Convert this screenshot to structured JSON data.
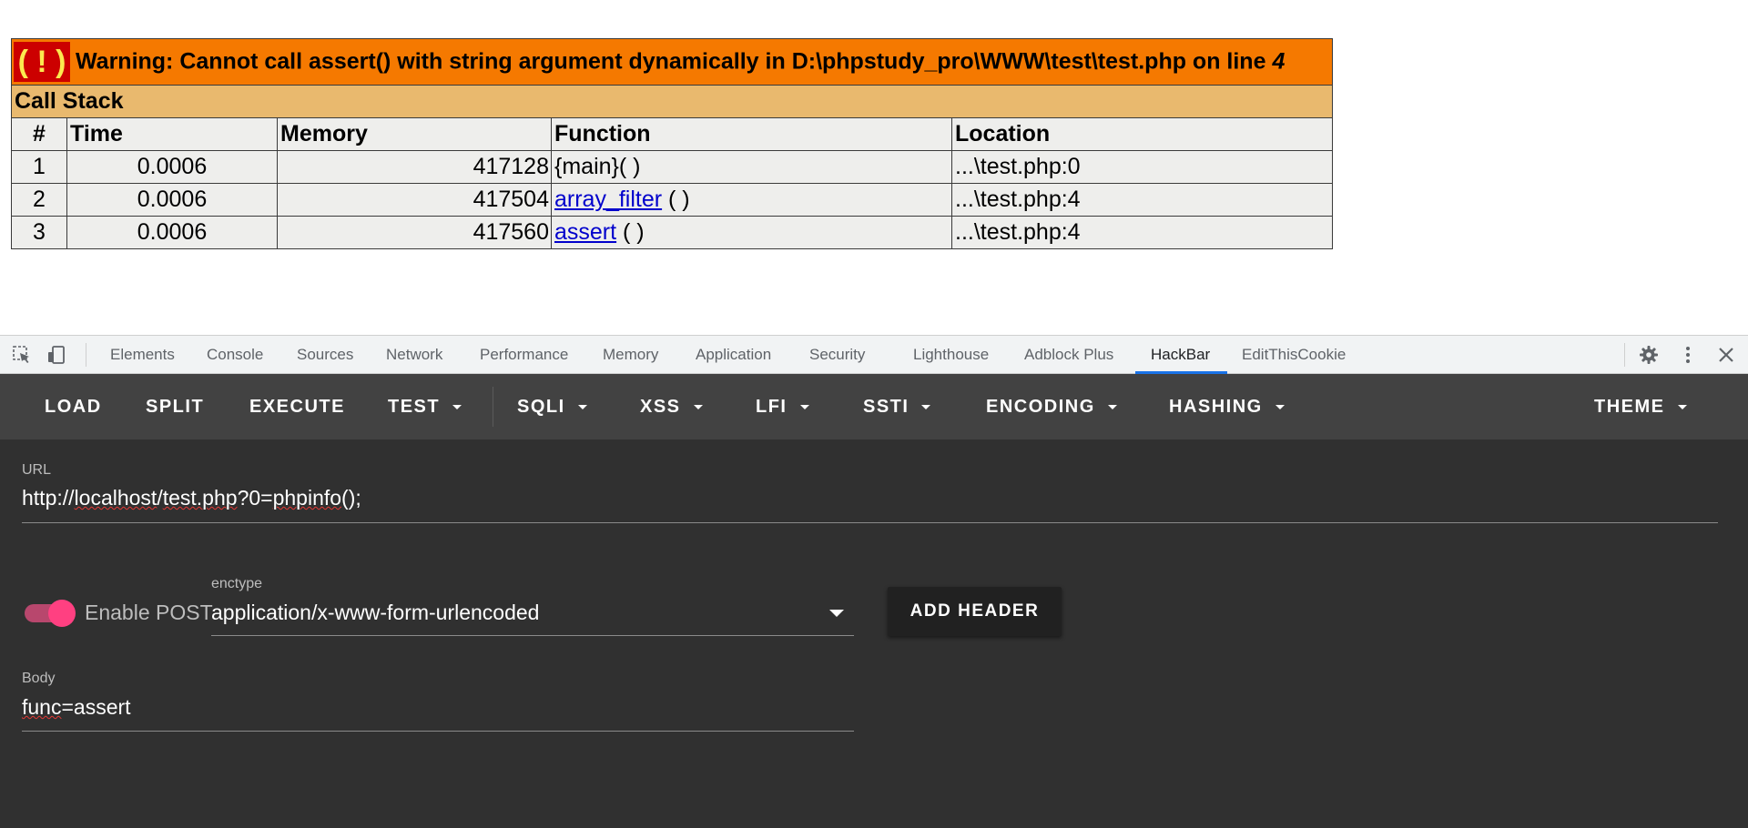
{
  "xdebug": {
    "warning_icon": "( ! )",
    "warning_text": "Warning: Cannot call assert() with string argument dynamically in D:\\phpstudy_pro\\WWW\\test\\test.php on line",
    "warning_line": "4",
    "call_stack_title": "Call Stack",
    "columns": [
      "#",
      "Time",
      "Memory",
      "Function",
      "Location"
    ],
    "rows": [
      {
        "num": "1",
        "time": "0.0006",
        "memory": "417128",
        "func_name": "",
        "func_plain": "{main}( )",
        "func_args": "",
        "location": "...\\test.php:0"
      },
      {
        "num": "2",
        "time": "0.0006",
        "memory": "417504",
        "func_name": "array_filter",
        "func_plain": "",
        "func_args": " ( )",
        "location": "...\\test.php:4"
      },
      {
        "num": "3",
        "time": "0.0006",
        "memory": "417560",
        "func_name": "assert",
        "func_plain": "",
        "func_args": " ( )",
        "location": "...\\test.php:4"
      }
    ]
  },
  "devtools": {
    "tabs": [
      "Elements",
      "Console",
      "Sources",
      "Network",
      "Performance",
      "Memory",
      "Application",
      "Security",
      "Lighthouse",
      "Adblock Plus",
      "HackBar",
      "EditThisCookie"
    ],
    "active_tab": "HackBar",
    "accent": "#1a73e8"
  },
  "hackbar": {
    "toolbar": {
      "load": "LOAD",
      "split": "SPLIT",
      "execute": "EXECUTE",
      "test": "TEST",
      "sqli": "SQLI",
      "xss": "XSS",
      "lfi": "LFI",
      "ssti": "SSTI",
      "encoding": "ENCODING",
      "hashing": "HASHING",
      "theme": "THEME"
    },
    "url_label": "URL",
    "url_parts": {
      "a": "http://",
      "b": "localhost",
      "c": "/",
      "d": "test.php",
      "e": "?0=",
      "f": "phpinfo",
      "g": "();"
    },
    "enable_post_label": "Enable POST",
    "enable_post_on": true,
    "enctype_label": "enctype",
    "enctype_value": "application/x-www-form-urlencoded",
    "add_header_label": "ADD HEADER",
    "body_label": "Body",
    "body_parts": {
      "a": "func",
      "b": "=assert"
    },
    "toggle_color": "#ff4081"
  }
}
